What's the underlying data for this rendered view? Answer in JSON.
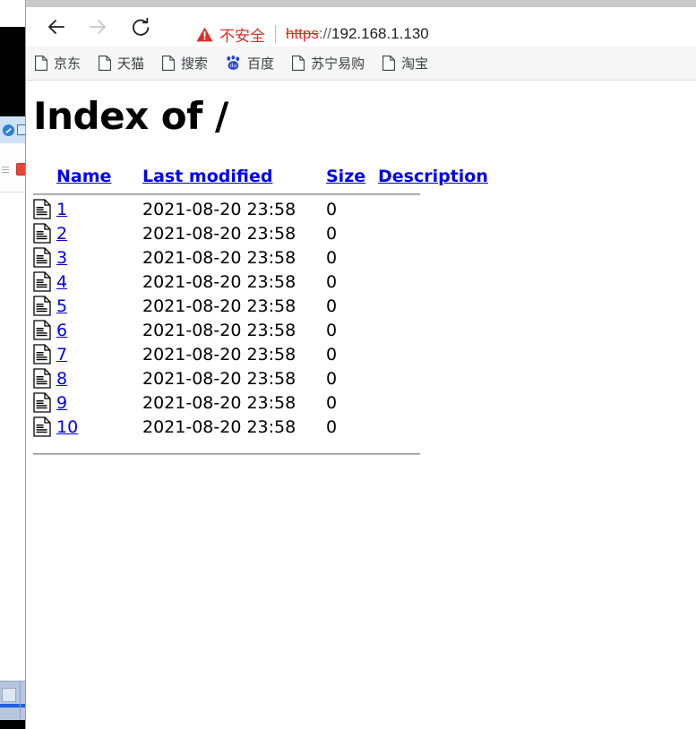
{
  "browser": {
    "nav": {
      "back_label": "Back",
      "forward_label": "Forward",
      "reload_label": "Reload"
    },
    "omnibox": {
      "security_label": "不安全",
      "security_icon": "warning-triangle-icon",
      "scheme": "https",
      "separator": "://",
      "host": "192.168.1.130",
      "full_url": "https://192.168.1.130",
      "security_color": "#d93025"
    },
    "bookmarks": [
      {
        "label": "京东",
        "icon": "document-icon"
      },
      {
        "label": "天猫",
        "icon": "document-icon"
      },
      {
        "label": "搜索",
        "icon": "document-icon"
      },
      {
        "label": "百度",
        "icon": "baidu-paw-icon"
      },
      {
        "label": "苏宁易购",
        "icon": "document-icon"
      },
      {
        "label": "淘宝",
        "icon": "document-icon"
      }
    ]
  },
  "page": {
    "title": "Index of /",
    "columns": {
      "name": "Name",
      "last_modified": "Last modified",
      "size": "Size",
      "description": "Description"
    },
    "link_color": "#0000ee",
    "rows": [
      {
        "icon": "text-file-icon",
        "name": "1",
        "last_modified": "2021-08-20 23:58",
        "size": "0",
        "description": ""
      },
      {
        "icon": "text-file-icon",
        "name": "2",
        "last_modified": "2021-08-20 23:58",
        "size": "0",
        "description": ""
      },
      {
        "icon": "text-file-icon",
        "name": "3",
        "last_modified": "2021-08-20 23:58",
        "size": "0",
        "description": ""
      },
      {
        "icon": "text-file-icon",
        "name": "4",
        "last_modified": "2021-08-20 23:58",
        "size": "0",
        "description": ""
      },
      {
        "icon": "text-file-icon",
        "name": "5",
        "last_modified": "2021-08-20 23:58",
        "size": "0",
        "description": ""
      },
      {
        "icon": "text-file-icon",
        "name": "6",
        "last_modified": "2021-08-20 23:58",
        "size": "0",
        "description": ""
      },
      {
        "icon": "text-file-icon",
        "name": "7",
        "last_modified": "2021-08-20 23:58",
        "size": "0",
        "description": ""
      },
      {
        "icon": "text-file-icon",
        "name": "8",
        "last_modified": "2021-08-20 23:58",
        "size": "0",
        "description": ""
      },
      {
        "icon": "text-file-icon",
        "name": "9",
        "last_modified": "2021-08-20 23:58",
        "size": "0",
        "description": ""
      },
      {
        "icon": "text-file-icon",
        "name": "10",
        "last_modified": "2021-08-20 23:58",
        "size": "0",
        "description": ""
      }
    ]
  }
}
